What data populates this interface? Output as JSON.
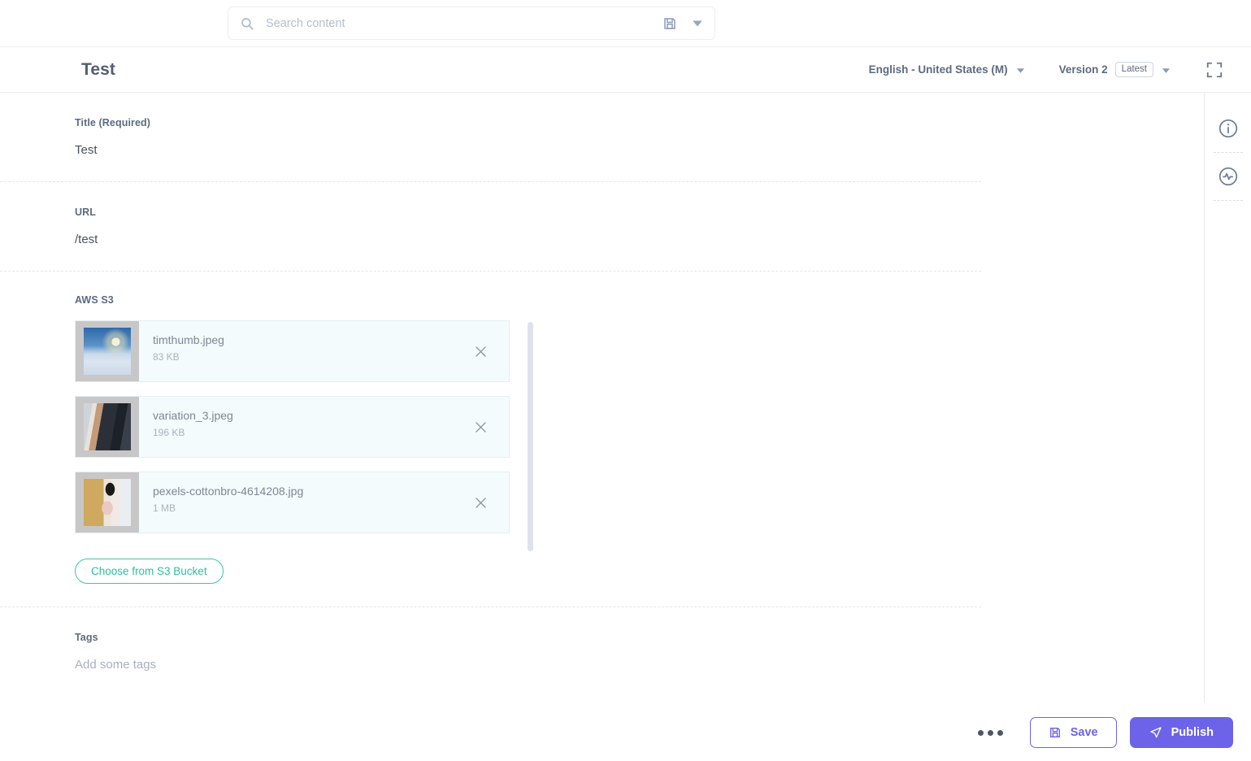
{
  "search": {
    "placeholder": "Search content",
    "value": "",
    "icons": {
      "search": "search-icon",
      "save": "save-disk-icon",
      "caret": "chevron-down-icon"
    }
  },
  "header": {
    "title": "Test",
    "language": "English - United States (M)",
    "version_label": "Version 2",
    "version_chip": "Latest",
    "expand_icon": "fullscreen-expand-icon"
  },
  "fields": {
    "title": {
      "label": "Title (Required)",
      "value": "Test"
    },
    "url": {
      "label": "URL",
      "value": "/test"
    },
    "aws_s3": {
      "label": "AWS S3",
      "choose_button": "Choose from S3 Bucket",
      "files": [
        {
          "name": "timthumb.jpeg",
          "size": "83 KB",
          "thumb": "snow-landscape",
          "remove_icon": "close-icon"
        },
        {
          "name": "variation_3.jpeg",
          "size": "196 KB",
          "thumb": "business-suit",
          "remove_icon": "close-icon"
        },
        {
          "name": "pexels-cottonbro-4614208.jpg",
          "size": "1 MB",
          "thumb": "pexels-photo",
          "remove_icon": "close-icon"
        }
      ]
    },
    "tags": {
      "label": "Tags",
      "placeholder": "Add some tags",
      "value": ""
    }
  },
  "right_rail": {
    "items": [
      {
        "name": "info-icon",
        "title": "Info"
      },
      {
        "name": "activity-pulse-icon",
        "title": "Activity"
      }
    ]
  },
  "footer": {
    "more_label": "More options",
    "save_label": "Save",
    "publish_label": "Publish",
    "save_icon": "save-disk-icon",
    "publish_icon": "send-paper-plane-icon"
  },
  "colors": {
    "accent_purple": "#6c63e8",
    "accent_teal": "#2bbfa3",
    "text_heading": "#525e73",
    "row_background": "#f4fbfc"
  }
}
